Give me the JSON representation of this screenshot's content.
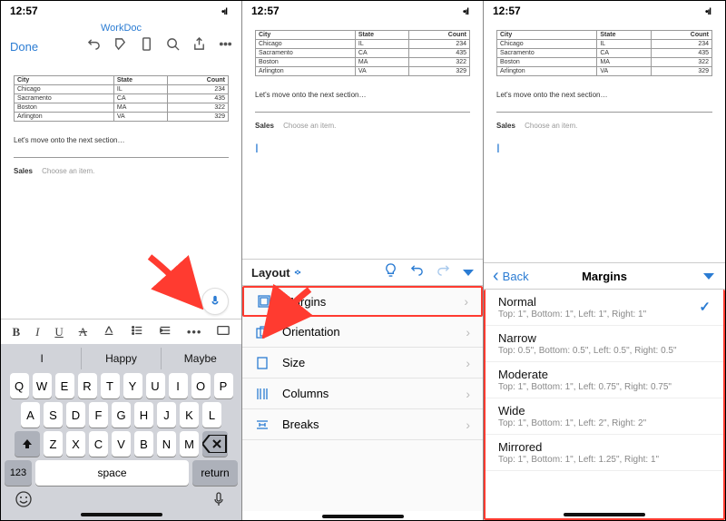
{
  "status": {
    "time": "12:57"
  },
  "header": {
    "title": "WorkDoc",
    "done": "Done"
  },
  "table": {
    "headers": [
      "City",
      "State",
      "Count"
    ],
    "rows": [
      [
        "Chicago",
        "IL",
        "234"
      ],
      [
        "Sacramento",
        "CA",
        "435"
      ],
      [
        "Boston",
        "MA",
        "322"
      ],
      [
        "Arlington",
        "VA",
        "329"
      ]
    ]
  },
  "paragraph": "Let's move onto the next section…",
  "sales": {
    "label": "Sales",
    "placeholder": "Choose an item."
  },
  "suggestions": [
    "I",
    "Happy",
    "Maybe"
  ],
  "kb": {
    "r1": [
      "Q",
      "W",
      "E",
      "R",
      "T",
      "Y",
      "U",
      "I",
      "O",
      "P"
    ],
    "r2": [
      "A",
      "S",
      "D",
      "F",
      "G",
      "H",
      "J",
      "K",
      "L"
    ],
    "r3": [
      "Z",
      "X",
      "C",
      "V",
      "B",
      "N",
      "M"
    ],
    "numKey": "123",
    "space": "space",
    "ret": "return"
  },
  "layout": {
    "tab": "Layout",
    "items": [
      "Margins",
      "Orientation",
      "Size",
      "Columns",
      "Breaks"
    ]
  },
  "margins": {
    "back": "Back",
    "title": "Margins",
    "options": [
      {
        "t": "Normal",
        "d": "Top: 1\", Bottom: 1\", Left: 1\", Right: 1\"",
        "sel": true
      },
      {
        "t": "Narrow",
        "d": "Top: 0.5\", Bottom: 0.5\", Left: 0.5\", Right: 0.5\""
      },
      {
        "t": "Moderate",
        "d": "Top: 1\", Bottom: 1\", Left: 0.75\", Right: 0.75\""
      },
      {
        "t": "Wide",
        "d": "Top: 1\", Bottom: 1\", Left: 2\", Right: 2\""
      },
      {
        "t": "Mirrored",
        "d": "Top: 1\", Bottom: 1\", Left: 1.25\", Right: 1\""
      }
    ]
  }
}
